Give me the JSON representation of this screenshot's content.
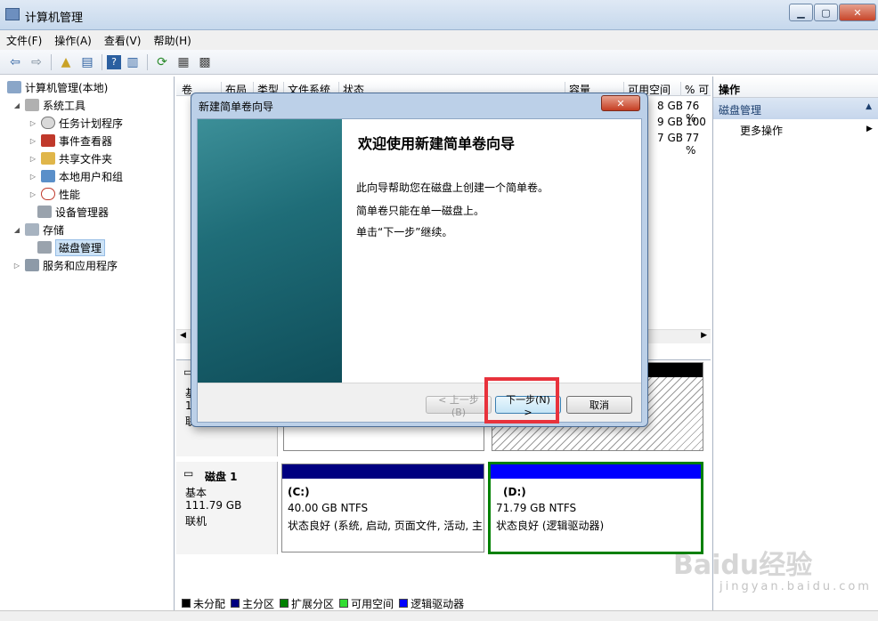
{
  "window": {
    "title": "计算机管理"
  },
  "menu": [
    "文件(F)",
    "操作(A)",
    "查看(V)",
    "帮助(H)"
  ],
  "tree": {
    "root": "计算机管理(本地)",
    "system_tools": "系统工具",
    "children": [
      "任务计划程序",
      "事件查看器",
      "共享文件夹",
      "本地用户和组",
      "性能",
      "设备管理器"
    ],
    "storage": "存储",
    "disk_mgmt": "磁盘管理",
    "services": "服务和应用程序"
  },
  "volume_table": {
    "headers": [
      "卷",
      "布局",
      "类型",
      "文件系统",
      "状态",
      "容量",
      "可用空间",
      "% 可"
    ],
    "rows": [
      {
        "free": "8 GB",
        "pct": "76 %"
      },
      {
        "free": "9 GB",
        "pct": "100"
      },
      {
        "free": "7 GB",
        "pct": "77 %"
      }
    ]
  },
  "disk0": {
    "name": "基",
    "size": "1",
    "status": "联"
  },
  "disk1": {
    "name": "磁盘 1",
    "type": "基本",
    "size": "111.79 GB",
    "status": "联机",
    "partitions": [
      {
        "label": "(C:)",
        "size": "40.00 GB NTFS",
        "status": "状态良好 (系统, 启动, 页面文件, 活动, 主"
      },
      {
        "label": "(D:)",
        "size": "71.79 GB NTFS",
        "status": "状态良好 (逻辑驱动器)"
      }
    ]
  },
  "legend": [
    {
      "label": "未分配",
      "color": "#000000"
    },
    {
      "label": "主分区",
      "color": "#000080"
    },
    {
      "label": "扩展分区",
      "color": "#008000"
    },
    {
      "label": "可用空间",
      "color": "#33dd33"
    },
    {
      "label": "逻辑驱动器",
      "color": "#0000ff"
    }
  ],
  "actions": {
    "title": "操作",
    "section": "磁盘管理",
    "more": "更多操作"
  },
  "wizard": {
    "title": "新建简单卷向导",
    "heading": "欢迎使用新建简单卷向导",
    "line1": "此向导帮助您在磁盘上创建一个简单卷。",
    "line2": "简单卷只能在单一磁盘上。",
    "line3": "单击“下一步”继续。",
    "back": "< 上一步(B)",
    "next": "下一步(N) >",
    "cancel": "取消"
  },
  "watermark": {
    "main": "Baidu经验",
    "sub": "jingyan.baidu.com"
  }
}
